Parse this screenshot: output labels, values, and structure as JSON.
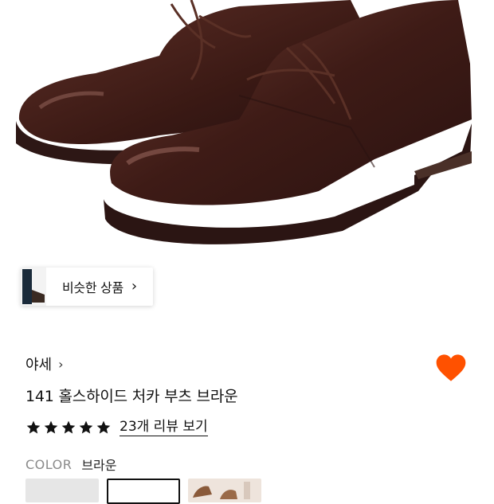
{
  "similar": {
    "label": "비슷한 상품",
    "chevron": "chevron-right-icon"
  },
  "product": {
    "brand": "야세",
    "brand_chevron": "chevron-right-icon",
    "title": "141 홀스하이드 처카 부츠 브라운",
    "rating": 5,
    "review_link": "23개 리뷰 보기",
    "wishlist_icon": "heart-icon",
    "wishlist_color": "#ff5100"
  },
  "color": {
    "label": "COLOR",
    "value": "브라운"
  },
  "colors": {
    "star": "#111111",
    "leather": "#3b1a15"
  }
}
